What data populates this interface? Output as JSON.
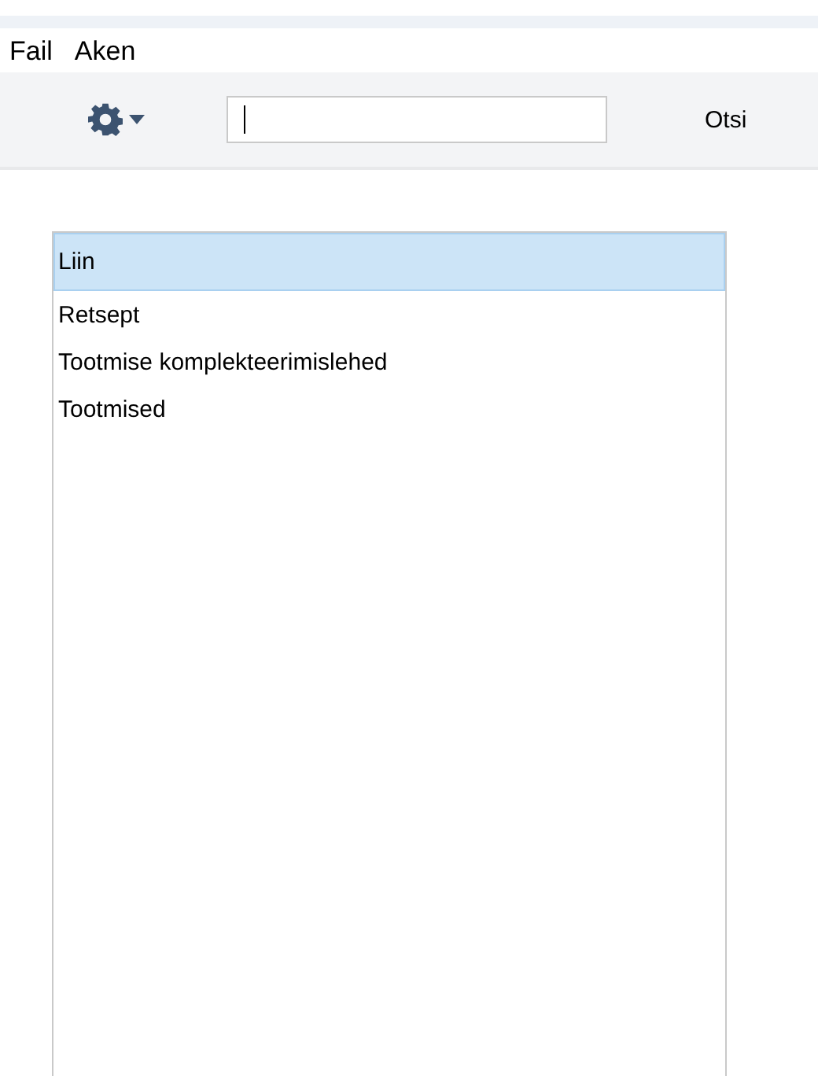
{
  "menu": [
    "Fail",
    "Aken"
  ],
  "toolbar": {
    "search_button": "Otsi"
  },
  "list": [
    {
      "label": "Liin",
      "selected": true
    },
    {
      "label": "Retsept",
      "selected": false
    },
    {
      "label": "Tootmise komplekteerimislehed",
      "selected": false
    },
    {
      "label": "Tootmised",
      "selected": false
    }
  ]
}
